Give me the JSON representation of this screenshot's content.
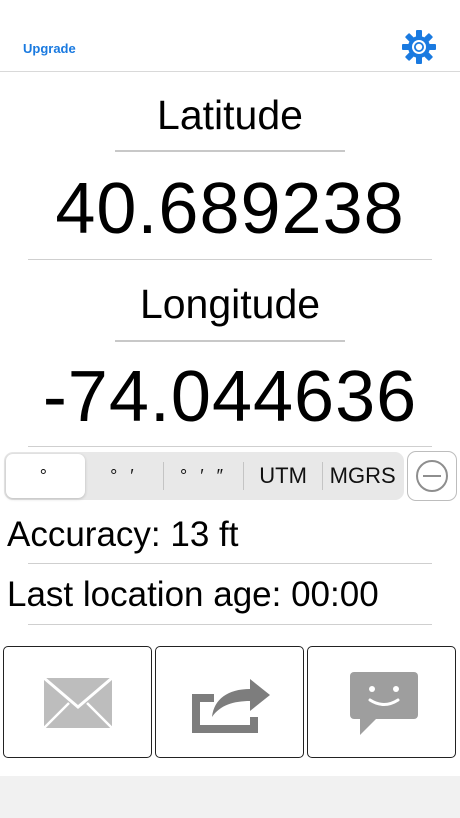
{
  "header": {
    "upgrade_label": "Upgrade",
    "settings_icon": "gear-icon",
    "accent_color": "#1a7ae0"
  },
  "coordinates": {
    "latitude_label": "Latitude",
    "latitude_value": "40.689238",
    "longitude_label": "Longitude",
    "longitude_value": "-74.044636"
  },
  "format_selector": {
    "options": [
      "°",
      "° ′",
      "° ′ ″",
      "UTM",
      "MGRS"
    ],
    "selected": "°",
    "extra_button_icon": "minus-circle-icon"
  },
  "status": {
    "accuracy": "Accuracy: 13 ft",
    "last_location_age": "Last location age: 00:00"
  },
  "actions": {
    "icons": [
      "mail-icon",
      "share-icon",
      "message-icon"
    ]
  }
}
